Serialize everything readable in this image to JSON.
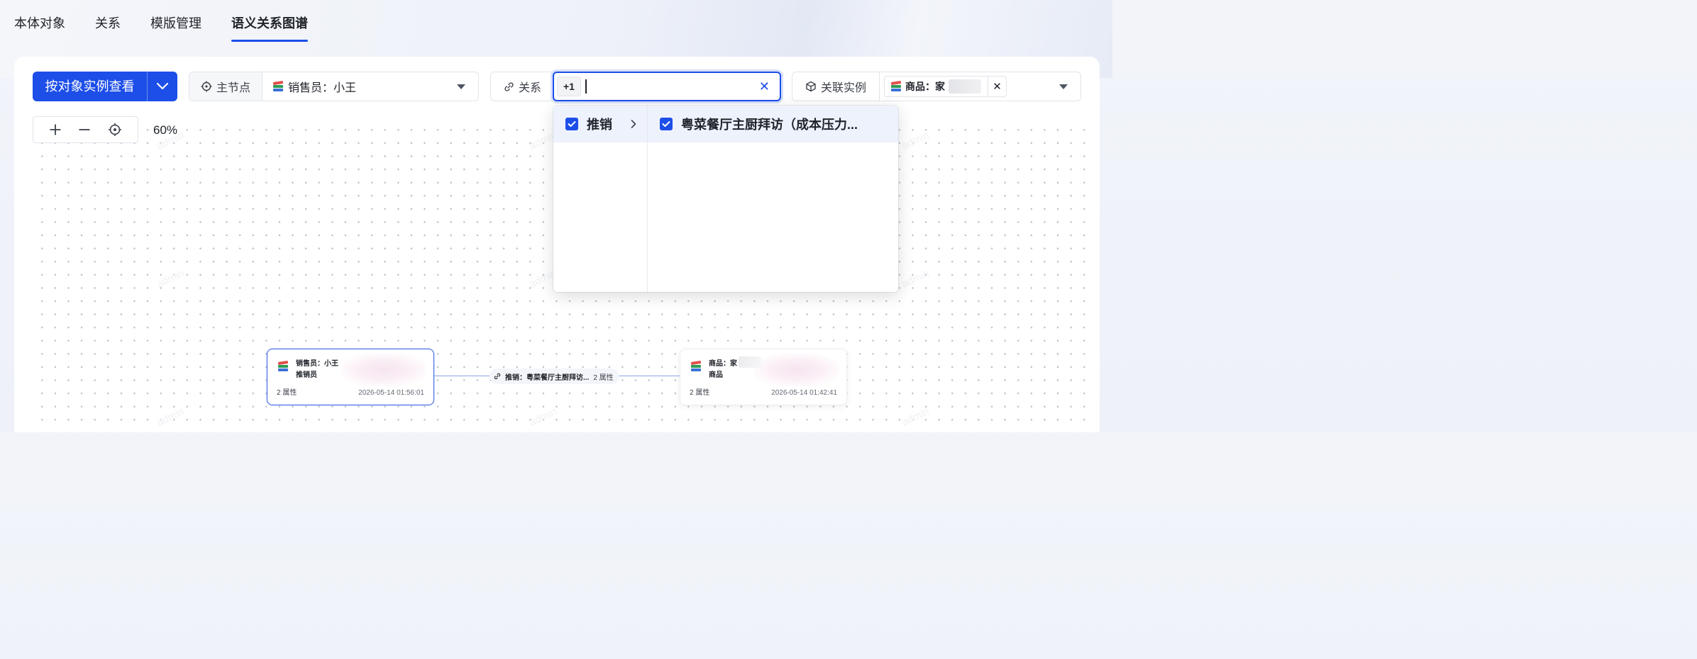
{
  "tabs": [
    {
      "label": "本体对象",
      "active": false
    },
    {
      "label": "关系",
      "active": false
    },
    {
      "label": "模版管理",
      "active": false
    },
    {
      "label": "语义关系图谱",
      "active": true
    }
  ],
  "toolbar": {
    "view_button_label": "按对象实例查看",
    "main_node": {
      "prefix_label": "主节点",
      "value": "销售员：小王"
    },
    "relation": {
      "prefix_label": "关系",
      "count_tag": "+1",
      "input_value": ""
    },
    "instance": {
      "prefix_label": "关联实例",
      "tag_label": "商品：家"
    }
  },
  "zoom": {
    "level": "60%"
  },
  "dropdown": {
    "categories": [
      {
        "label": "推销",
        "checked": true
      }
    ],
    "items": [
      {
        "label": "粤菜餐厅主厨拜访（成本压力...",
        "checked": true
      }
    ]
  },
  "graph": {
    "source_node": {
      "title": "销售员：小王",
      "type": "推销员",
      "attr_count": "2 属性",
      "timestamp": "2026-05-14 01:56:01"
    },
    "edge": {
      "label": "推销：粤菜餐厅主厨拜访...",
      "attr_count": "2 属性"
    },
    "target_node": {
      "title": "商品：家",
      "type": "商品",
      "attr_count": "2 属性",
      "timestamp": "2026-05-14 01:42:41"
    }
  },
  "colors": {
    "primary": "#1d4ee8",
    "node_border": "#3a66e6"
  },
  "watermark": "admin"
}
